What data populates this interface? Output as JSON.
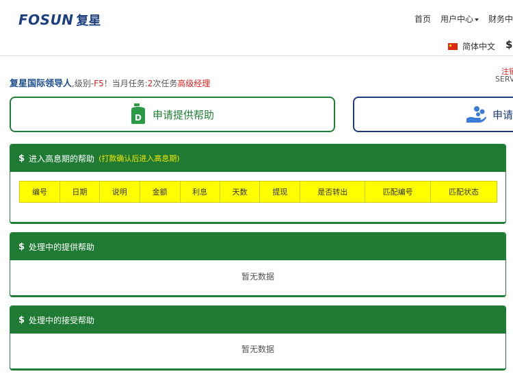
{
  "brand": {
    "logo_en": "FOSUN",
    "logo_cn": "复星"
  },
  "nav": {
    "home": "首页",
    "user_center": "用户中心",
    "finance": "财务中"
  },
  "lang": {
    "label": "简体中文",
    "currency_symbol": "$"
  },
  "info": {
    "name": "复星国际领导人",
    "level_prefix": ",级别-",
    "level": "F5",
    "task_prefix": "！当月任务:",
    "task_count": "2",
    "task_suffix": "次任务",
    "title": "高级经理"
  },
  "right_top": {
    "red_text": "注销",
    "gray_text": "SERV"
  },
  "buttons": {
    "provide_help": "申请提供帮助",
    "accept_help": "申请",
    "provide_icon_letter": "D"
  },
  "panels": {
    "high_interest": {
      "title": "进入高息期的帮助",
      "note": "(打款确认后进入高息期)",
      "columns": [
        "编号",
        "日期",
        "说明",
        "金额",
        "利息",
        "天数",
        "提现",
        "是否转出",
        "匹配编号",
        "匹配状态"
      ]
    },
    "processing_provide": {
      "title": "处理中的提供帮助",
      "empty": "暂无数据"
    },
    "processing_accept": {
      "title": "处理中的接受帮助",
      "empty": "暂无数据"
    }
  },
  "colors": {
    "green": "#1f7a33",
    "blue": "#1e3a78",
    "yellow": "#ffff00",
    "red": "#e02020"
  }
}
